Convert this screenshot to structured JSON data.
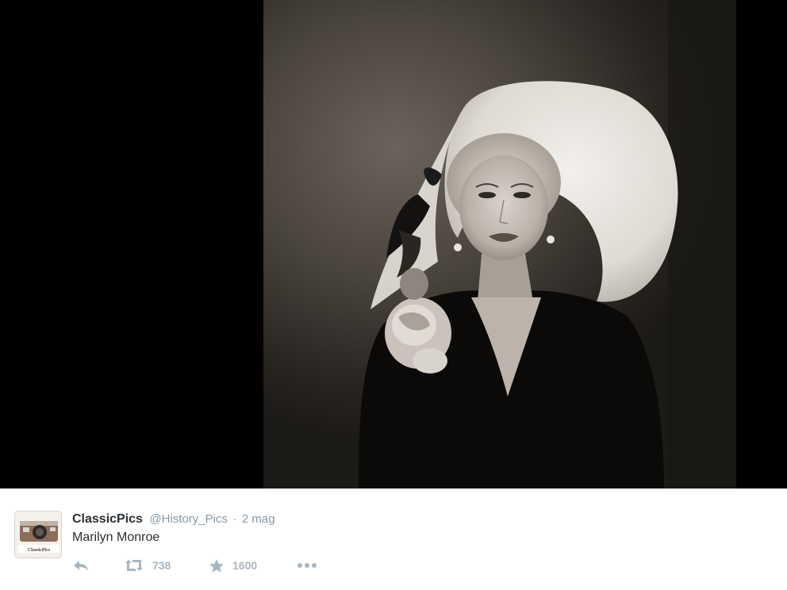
{
  "tweet": {
    "display_name": "ClassicPics",
    "handle": "@History_Pics",
    "separator": "·",
    "timestamp": "2 mag",
    "text": "Marilyn Monroe",
    "avatar_label": "ClassicPics",
    "retweet_count": "738",
    "favorite_count": "1600"
  },
  "icons": {
    "reply": "reply-icon",
    "retweet": "retweet-icon",
    "favorite": "star-icon",
    "more": "more-dots-icon"
  },
  "colors": {
    "name": "#292f33",
    "muted": "#8899a6",
    "action": "#a8b6c1",
    "media_bg": "#000000"
  }
}
